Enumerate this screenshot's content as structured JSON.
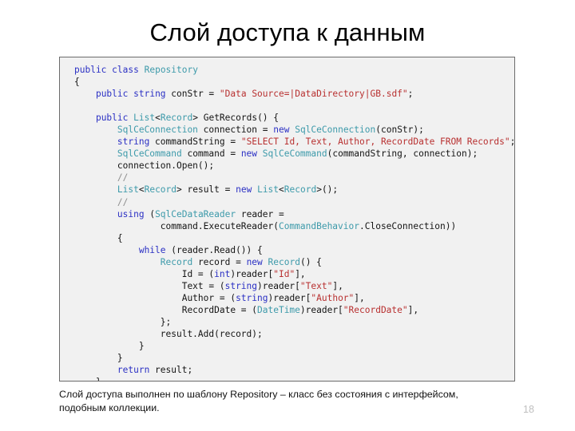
{
  "slide": {
    "title": "Слой доступа к данным",
    "page_number": "18",
    "caption": "Слой доступа выполнен по шаблону Repository – класс без состояния с интерфейсом, подобным коллекции."
  },
  "colors": {
    "keyword": "#2b30c4",
    "type": "#3d9aaa",
    "string": "#b83030",
    "comment": "#8d8d8d",
    "plain": "#141414",
    "code_background": "#f1f1f1",
    "code_border": "#6b6b6b",
    "slide_background": "#ffffff",
    "page_number": "#bfbfbf"
  },
  "code": {
    "language": "csharp",
    "lines": [
      [
        {
          "t": "public",
          "c": "kw"
        },
        {
          "t": " ",
          "c": "plain"
        },
        {
          "t": "class",
          "c": "kw"
        },
        {
          "t": " ",
          "c": "plain"
        },
        {
          "t": "Repository",
          "c": "typ"
        }
      ],
      [
        {
          "t": "{",
          "c": "plain"
        }
      ],
      [
        {
          "t": "    ",
          "c": "plain"
        },
        {
          "t": "public",
          "c": "kw"
        },
        {
          "t": " ",
          "c": "plain"
        },
        {
          "t": "string",
          "c": "kw"
        },
        {
          "t": " conStr = ",
          "c": "plain"
        },
        {
          "t": "\"Data Source=|DataDirectory|GB.sdf\"",
          "c": "str"
        },
        {
          "t": ";",
          "c": "plain"
        }
      ],
      [
        {
          "t": "",
          "c": "plain"
        }
      ],
      [
        {
          "t": "    ",
          "c": "plain"
        },
        {
          "t": "public",
          "c": "kw"
        },
        {
          "t": " ",
          "c": "plain"
        },
        {
          "t": "List",
          "c": "typ"
        },
        {
          "t": "<",
          "c": "plain"
        },
        {
          "t": "Record",
          "c": "typ"
        },
        {
          "t": "> GetRecords() {",
          "c": "plain"
        }
      ],
      [
        {
          "t": "        ",
          "c": "plain"
        },
        {
          "t": "SqlCeConnection",
          "c": "typ"
        },
        {
          "t": " connection = ",
          "c": "plain"
        },
        {
          "t": "new",
          "c": "kw"
        },
        {
          "t": " ",
          "c": "plain"
        },
        {
          "t": "SqlCeConnection",
          "c": "typ"
        },
        {
          "t": "(conStr);",
          "c": "plain"
        }
      ],
      [
        {
          "t": "        ",
          "c": "plain"
        },
        {
          "t": "string",
          "c": "kw"
        },
        {
          "t": " commandString = ",
          "c": "plain"
        },
        {
          "t": "\"SELECT Id, Text, Author, RecordDate FROM Records\"",
          "c": "str"
        },
        {
          "t": ";",
          "c": "plain"
        }
      ],
      [
        {
          "t": "        ",
          "c": "plain"
        },
        {
          "t": "SqlCeCommand",
          "c": "typ"
        },
        {
          "t": " command = ",
          "c": "plain"
        },
        {
          "t": "new",
          "c": "kw"
        },
        {
          "t": " ",
          "c": "plain"
        },
        {
          "t": "SqlCeCommand",
          "c": "typ"
        },
        {
          "t": "(commandString, connection);",
          "c": "plain"
        }
      ],
      [
        {
          "t": "        connection.Open();",
          "c": "plain"
        }
      ],
      [
        {
          "t": "        ",
          "c": "plain"
        },
        {
          "t": "//",
          "c": "cmt"
        }
      ],
      [
        {
          "t": "        ",
          "c": "plain"
        },
        {
          "t": "List",
          "c": "typ"
        },
        {
          "t": "<",
          "c": "plain"
        },
        {
          "t": "Record",
          "c": "typ"
        },
        {
          "t": "> result = ",
          "c": "plain"
        },
        {
          "t": "new",
          "c": "kw"
        },
        {
          "t": " ",
          "c": "plain"
        },
        {
          "t": "List",
          "c": "typ"
        },
        {
          "t": "<",
          "c": "plain"
        },
        {
          "t": "Record",
          "c": "typ"
        },
        {
          "t": ">();",
          "c": "plain"
        }
      ],
      [
        {
          "t": "        ",
          "c": "plain"
        },
        {
          "t": "//",
          "c": "cmt"
        }
      ],
      [
        {
          "t": "        ",
          "c": "plain"
        },
        {
          "t": "using",
          "c": "kw"
        },
        {
          "t": " (",
          "c": "plain"
        },
        {
          "t": "SqlCeDataReader",
          "c": "typ"
        },
        {
          "t": " reader =",
          "c": "plain"
        }
      ],
      [
        {
          "t": "                command.ExecuteReader(",
          "c": "plain"
        },
        {
          "t": "CommandBehavior",
          "c": "typ"
        },
        {
          "t": ".CloseConnection))",
          "c": "plain"
        }
      ],
      [
        {
          "t": "        {",
          "c": "plain"
        }
      ],
      [
        {
          "t": "            ",
          "c": "plain"
        },
        {
          "t": "while",
          "c": "kw"
        },
        {
          "t": " (reader.Read()) {",
          "c": "plain"
        }
      ],
      [
        {
          "t": "                ",
          "c": "plain"
        },
        {
          "t": "Record",
          "c": "typ"
        },
        {
          "t": " record = ",
          "c": "plain"
        },
        {
          "t": "new",
          "c": "kw"
        },
        {
          "t": " ",
          "c": "plain"
        },
        {
          "t": "Record",
          "c": "typ"
        },
        {
          "t": "() {",
          "c": "plain"
        }
      ],
      [
        {
          "t": "                    Id = (",
          "c": "plain"
        },
        {
          "t": "int",
          "c": "kw"
        },
        {
          "t": ")reader[",
          "c": "plain"
        },
        {
          "t": "\"Id\"",
          "c": "str"
        },
        {
          "t": "],",
          "c": "plain"
        }
      ],
      [
        {
          "t": "                    Text = (",
          "c": "plain"
        },
        {
          "t": "string",
          "c": "kw"
        },
        {
          "t": ")reader[",
          "c": "plain"
        },
        {
          "t": "\"Text\"",
          "c": "str"
        },
        {
          "t": "],",
          "c": "plain"
        }
      ],
      [
        {
          "t": "                    Author = (",
          "c": "plain"
        },
        {
          "t": "string",
          "c": "kw"
        },
        {
          "t": ")reader[",
          "c": "plain"
        },
        {
          "t": "\"Author\"",
          "c": "str"
        },
        {
          "t": "],",
          "c": "plain"
        }
      ],
      [
        {
          "t": "                    RecordDate = (",
          "c": "plain"
        },
        {
          "t": "DateTime",
          "c": "typ"
        },
        {
          "t": ")reader[",
          "c": "plain"
        },
        {
          "t": "\"RecordDate\"",
          "c": "str"
        },
        {
          "t": "],",
          "c": "plain"
        }
      ],
      [
        {
          "t": "                };",
          "c": "plain"
        }
      ],
      [
        {
          "t": "                result.Add(record);",
          "c": "plain"
        }
      ],
      [
        {
          "t": "            }",
          "c": "plain"
        }
      ],
      [
        {
          "t": "        }",
          "c": "plain"
        }
      ],
      [
        {
          "t": "        ",
          "c": "plain"
        },
        {
          "t": "return",
          "c": "kw"
        },
        {
          "t": " result;",
          "c": "plain"
        }
      ],
      [
        {
          "t": "    }",
          "c": "plain"
        }
      ],
      [
        {
          "t": "}",
          "c": "plain"
        }
      ]
    ]
  }
}
